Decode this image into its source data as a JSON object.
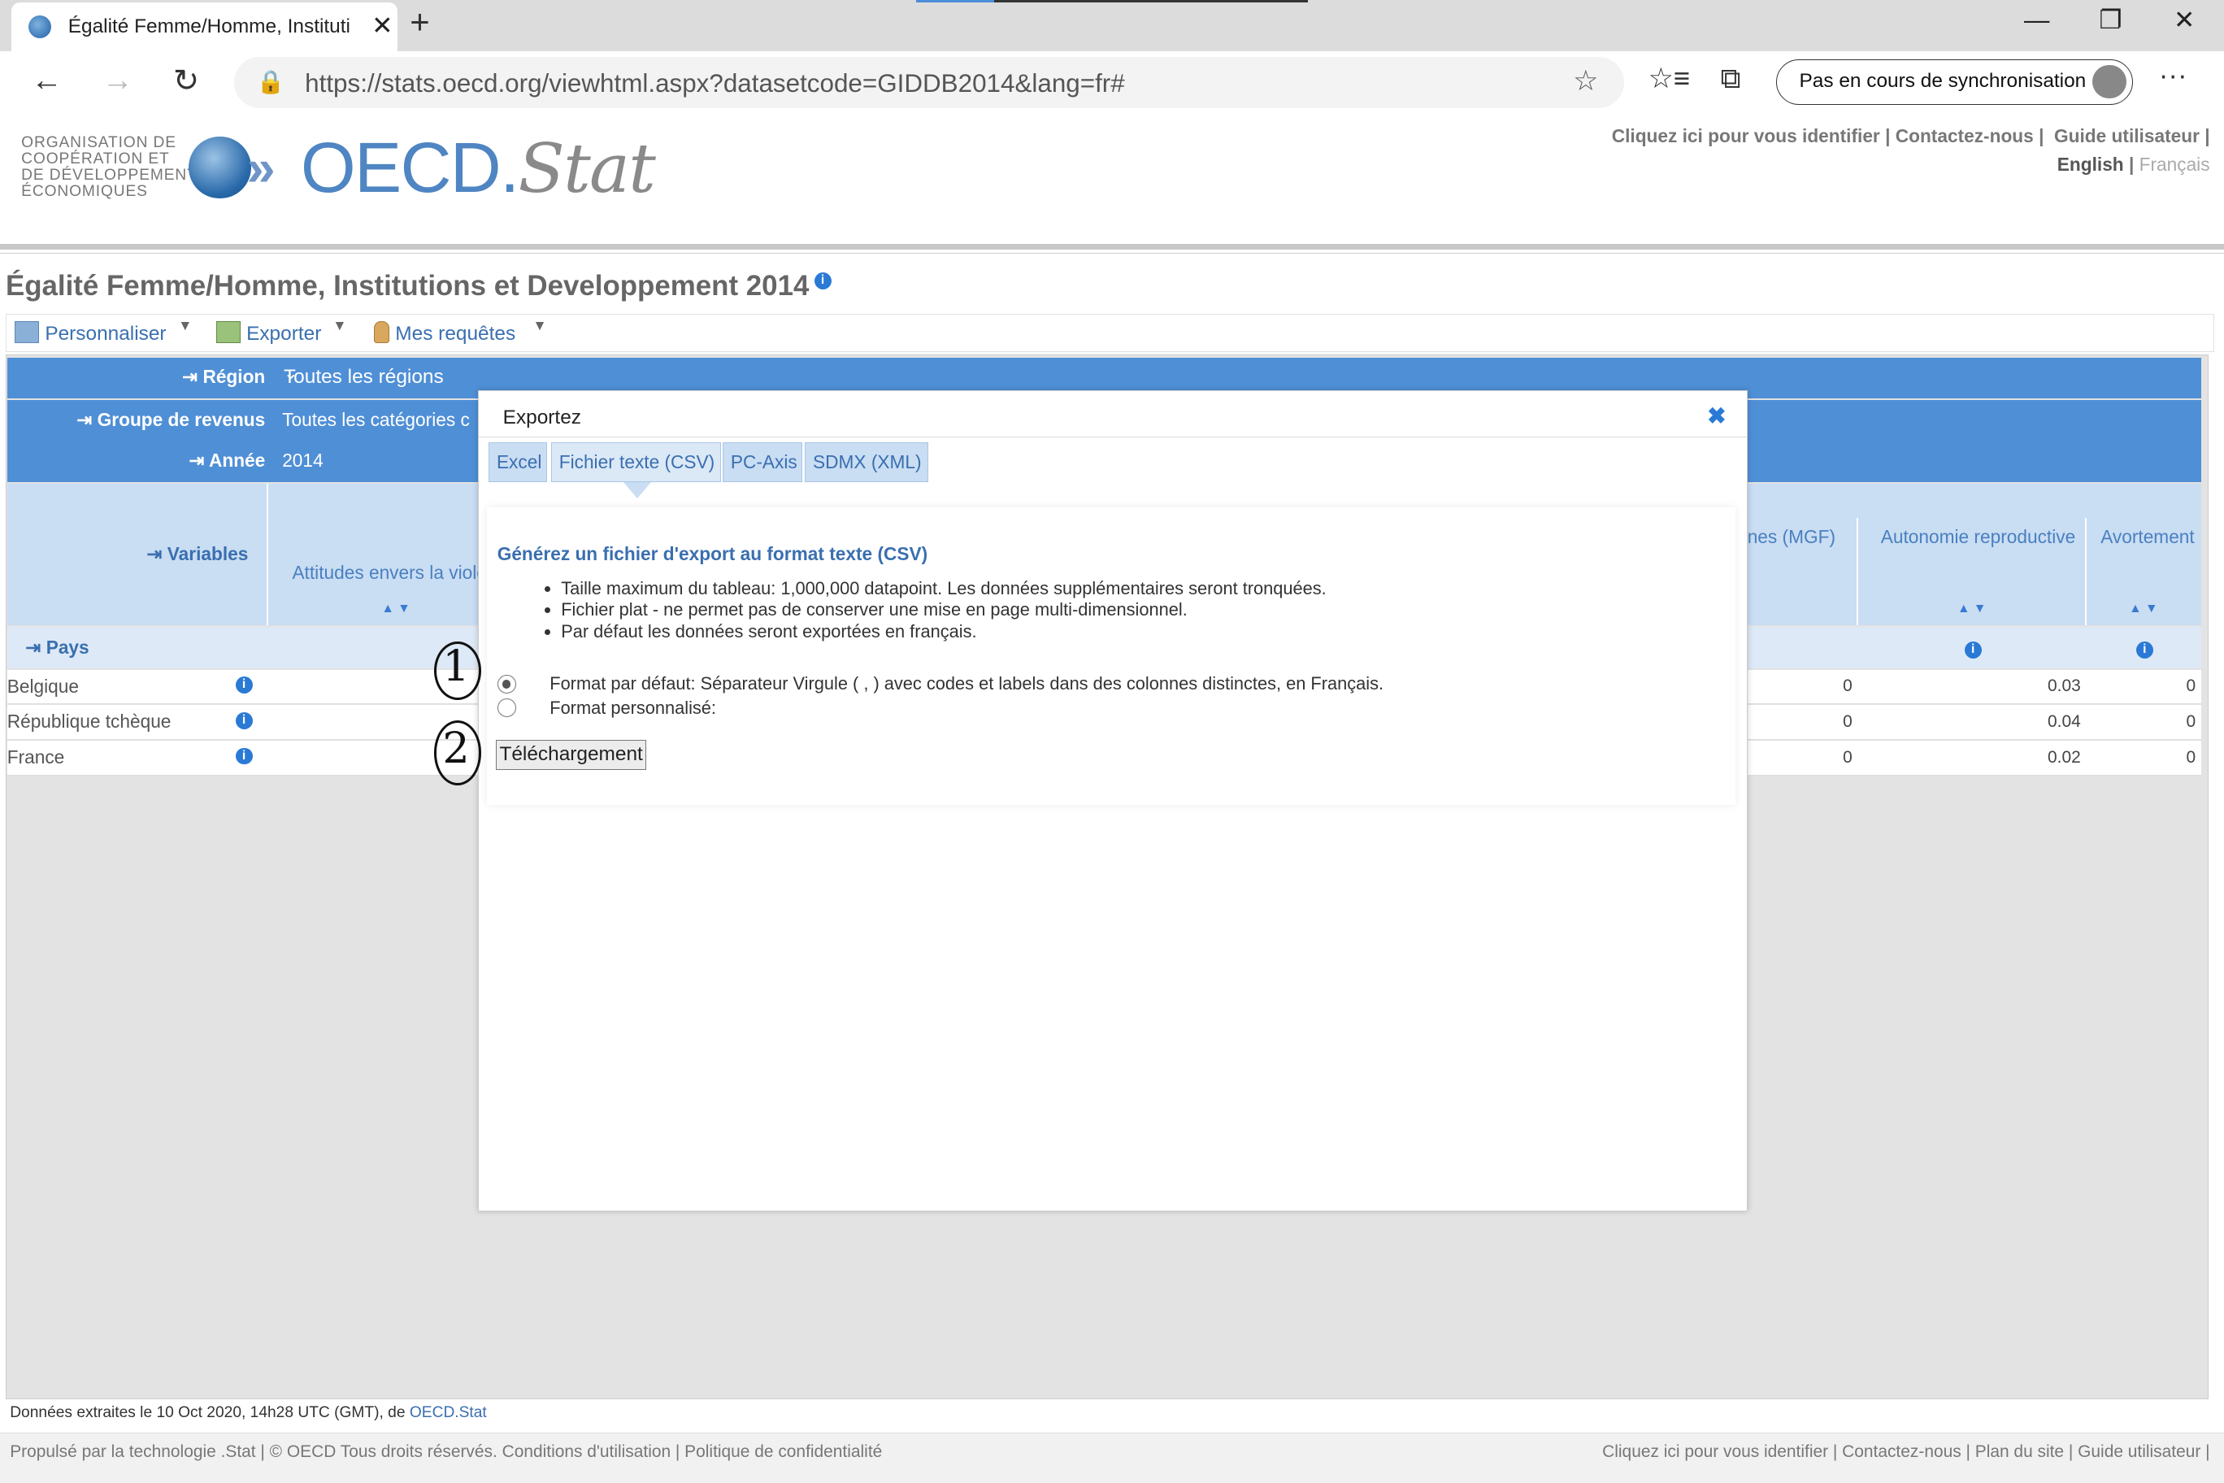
{
  "browser": {
    "tab_title": "Égalité Femme/Homme, Instituti",
    "url_host": "https://stats.oecd.org",
    "url_path": "/viewhtml.aspx?datasetcode=GIDDB2014&lang=fr#",
    "sync_label": "Pas en cours de synchronisation"
  },
  "header": {
    "org_lines": [
      "ORGANISATION DE",
      "COOPÉRATION ET",
      "DE DÉVELOPPEMENT",
      "ÉCONOMIQUES"
    ],
    "logo_main": "OECD",
    "logo_dot": ".",
    "logo_stat": "Stat",
    "link_login": "Cliquez ici pour vous identifier",
    "link_contact": "Contactez-nous",
    "link_guide": "Guide utilisateur",
    "lang_en": "English",
    "lang_fr": "Français"
  },
  "page": {
    "title": "Égalité Femme/Homme, Institutions et Developpement 2014"
  },
  "toolbar": {
    "customize": "Personnaliser",
    "export": "Exporter",
    "queries": "Mes requêtes"
  },
  "dimensions": {
    "region_label": "Région",
    "region_value": "Toutes les régions",
    "income_label": "Groupe de revenus",
    "income_value": "Toutes les catégories c",
    "year_label": "Année",
    "year_value": "2014",
    "variables_label": "Variables",
    "countries_label": "Pays"
  },
  "columns": {
    "col1": "Attitudes envers la viole",
    "col_mgf": "nes (MGF)",
    "col_repro": "Autonomie reproductive",
    "col_abort": "Avortement"
  },
  "rows": [
    {
      "name": "Belgique",
      "mgf": "0",
      "repro": "0.03",
      "abort": "0"
    },
    {
      "name": "République tchèque",
      "mgf": "0",
      "repro": "0.04",
      "abort": "0"
    },
    {
      "name": "France",
      "mgf": "0",
      "repro": "0.02",
      "abort": "0"
    }
  ],
  "modal": {
    "title": "Exportez",
    "tabs": [
      "Excel",
      "Fichier texte (CSV)",
      "PC-Axis",
      "SDMX (XML)"
    ],
    "heading": "Générez un fichier d'export au format texte (CSV)",
    "bullets": [
      "Taille maximum du tableau: 1,000,000 datapoint. Les données supplémentaires seront tronquées.",
      "Fichier plat - ne permet pas de conserver une mise en page multi-dimensionnel.",
      "Par défaut les données seront exportées en français."
    ],
    "option_default": "Format par défaut: Séparateur Virgule ( , ) avec codes et labels dans des colonnes distinctes, en Français.",
    "option_custom": "Format personnalisé:",
    "download_button": "Téléchargement",
    "annotation_1": "1",
    "annotation_2": "2"
  },
  "footer": {
    "extracted": "Données extraites le 10 Oct 2020, 14h28 UTC (GMT), de",
    "extracted_link": "OECD.Stat",
    "left": "Propulsé par la technologie .Stat | © OECD Tous droits réservés. Conditions d'utilisation | Politique de confidentialité",
    "right": "Cliquez ici pour vous identifier | Contactez-nous | Plan du site | Guide utilisateur |"
  }
}
